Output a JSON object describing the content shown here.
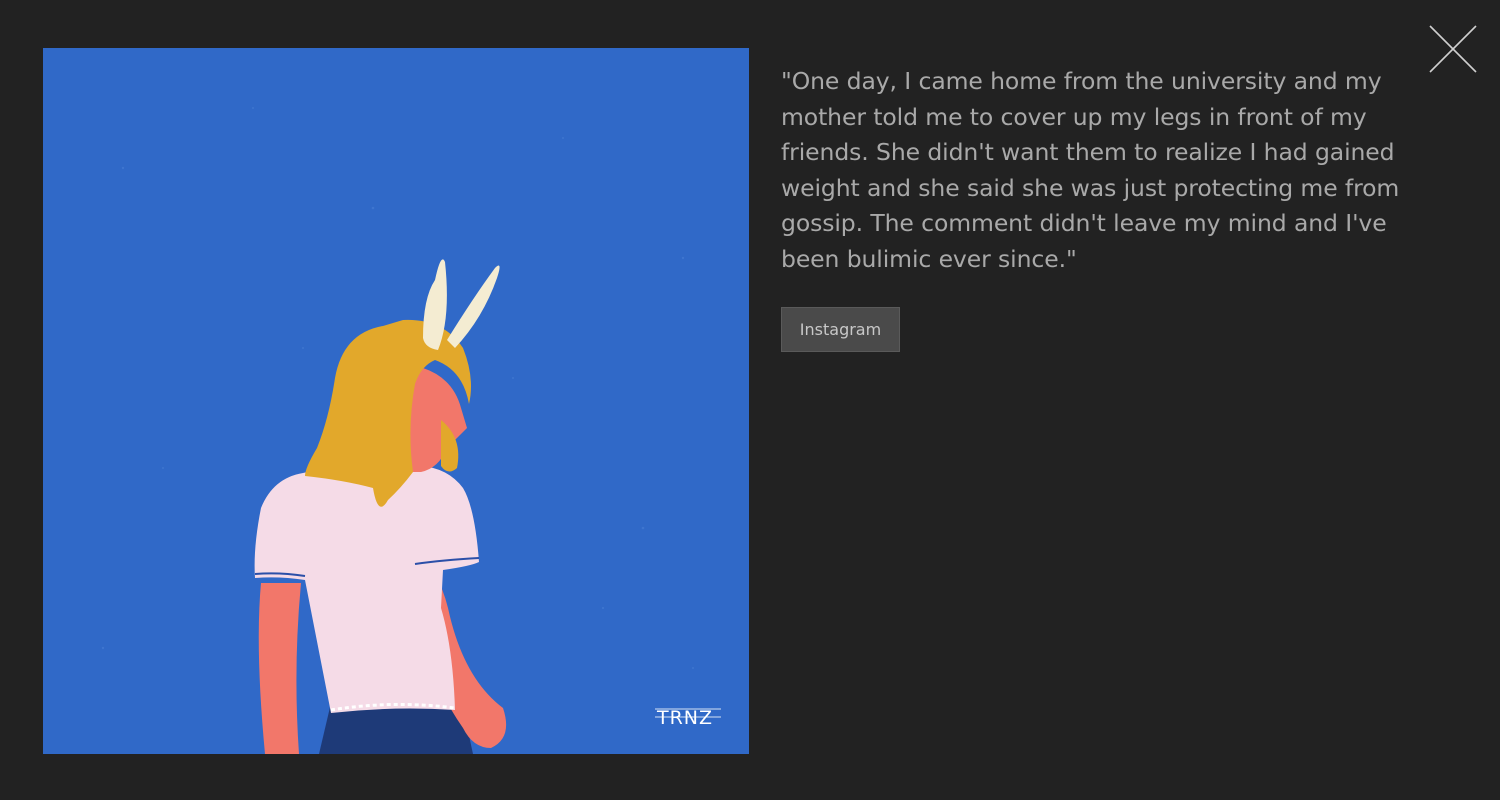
{
  "lightbox": {
    "quote": "\"One day, I came home from the university and my mother told me to cover up my legs in front of my friends. She didn't want them to realize I had gained weight and she said she was just protecting me from gossip. The comment didn't leave my mind and I've been bulimic ever since.\"",
    "instagram_button": "Instagram",
    "artwork_signature": "TRNZ",
    "close_icon": "close-icon"
  },
  "colors": {
    "backdrop": "#222222",
    "artwork_background": "#3069c8",
    "hair": "#e2a82b",
    "skin": "#f2776a",
    "shirt": "#f5dbe7",
    "skirt": "#1e3a78",
    "ears": "#f4ecd2"
  }
}
